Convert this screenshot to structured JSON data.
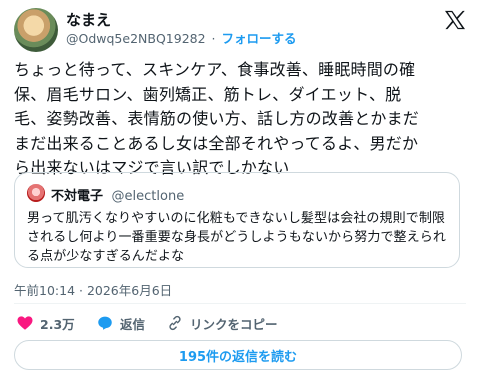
{
  "author": {
    "name": "なまえ",
    "handle": "@Odwq5e2NBQ19282",
    "separator": "·",
    "follow_label": "フォローする"
  },
  "tweet": {
    "lines": [
      "ちょっと待って、スキンケア、食事改善、睡眠時間の確",
      "保、眉毛サロン、歯列矯正、筋トレ、ダイエット、脱",
      "毛、姿勢改善、表情筋の使い方、話し方の改善とかまだ",
      "まだ出来ることあるし女は全部それやってるよ、男だか",
      "ら出来ないはマジで言い訳でしかない"
    ]
  },
  "quote": {
    "name": "不対電子",
    "handle": "@electlone",
    "lines": [
      "男って肌汚くなりやすいのに化粧もできないし髪型は会社の規則で制限",
      "されるし何より一番重要な身長がどうしようもないから努力で整えられ",
      "る点が少なすぎるんだよな"
    ]
  },
  "timestamp": "午前10:14 · 2026年6月6日",
  "actions": {
    "like_count": "2.3万",
    "reply_label": "返信",
    "copy_link_label": "リンクをコピー"
  },
  "read_replies_label": "195件の返信を読む",
  "colors": {
    "accent": "#1d9bf0",
    "like": "#f91880",
    "text": "#0f1419",
    "muted": "#536471",
    "border": "#cfd9de"
  },
  "icons": [
    "x-logo-icon",
    "heart-icon",
    "reply-icon",
    "link-icon"
  ]
}
